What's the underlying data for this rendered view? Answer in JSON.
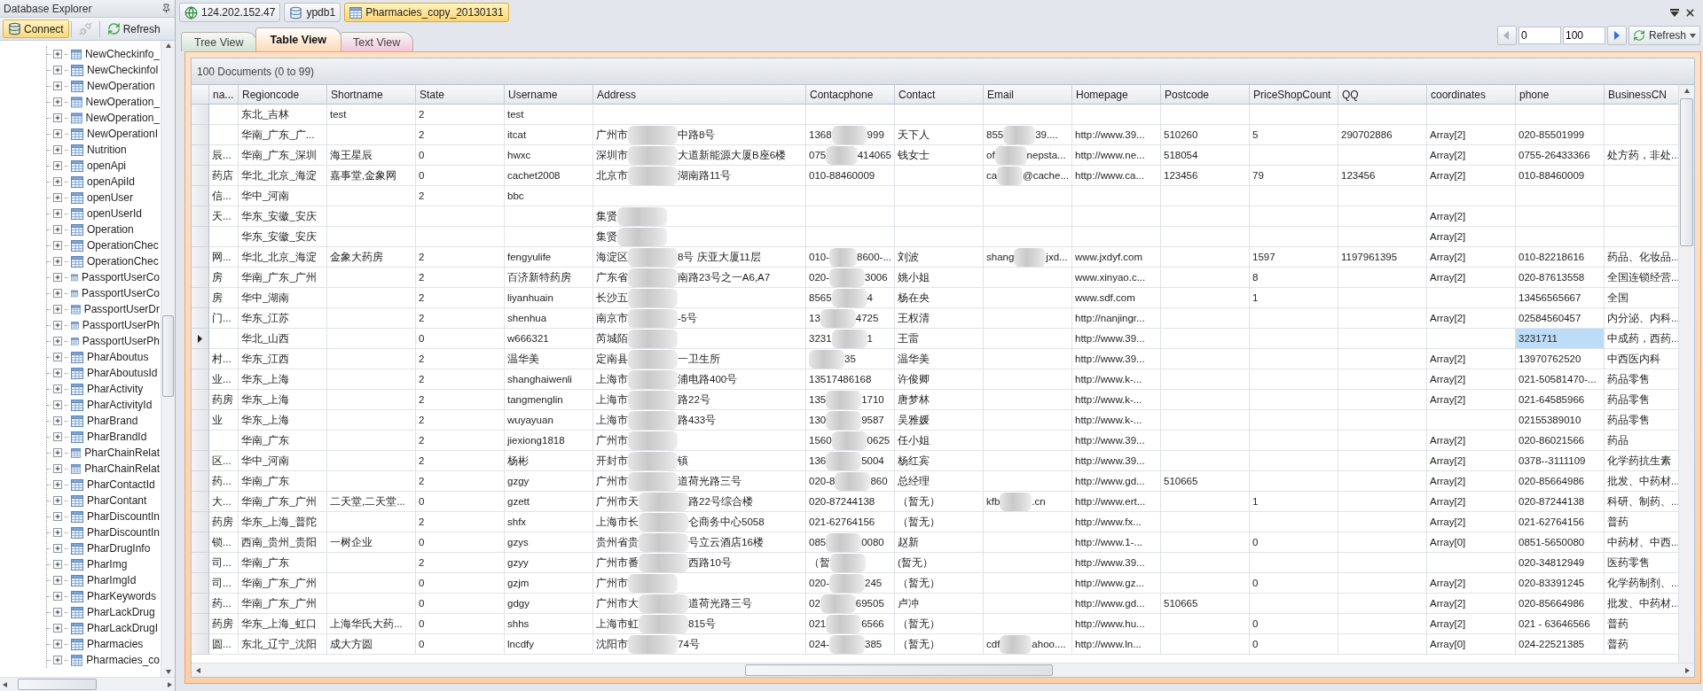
{
  "explorer": {
    "title": "Database Explorer",
    "toolbar": [
      {
        "kind": "connect",
        "label": "Connect",
        "active": true,
        "disabled": false
      },
      {
        "kind": "disconnect",
        "active": false,
        "disabled": true
      },
      {
        "kind": "refresh",
        "label": "Refresh",
        "active": false,
        "disabled": false
      }
    ],
    "items": [
      {
        "label": "NewCheckinfo_",
        "expanded": false
      },
      {
        "label": "NewCheckinfoI",
        "expanded": false
      },
      {
        "label": "NewOperation",
        "expanded": false
      },
      {
        "label": "NewOperation_",
        "expanded": false
      },
      {
        "label": "NewOperation_",
        "expanded": false
      },
      {
        "label": "NewOperationI",
        "expanded": false
      },
      {
        "label": "Nutrition",
        "expanded": false
      },
      {
        "label": "openApi",
        "expanded": false
      },
      {
        "label": "openApiId",
        "expanded": false
      },
      {
        "label": "openUser",
        "expanded": false
      },
      {
        "label": "openUserId",
        "expanded": false
      },
      {
        "label": "Operation",
        "expanded": false
      },
      {
        "label": "OperationChec",
        "expanded": false
      },
      {
        "label": "OperationChec",
        "expanded": false
      },
      {
        "label": "PassportUserCo",
        "expanded": false
      },
      {
        "label": "PassportUserCo",
        "expanded": false
      },
      {
        "label": "PassportUserDr",
        "expanded": false
      },
      {
        "label": "PassportUserPh",
        "expanded": false
      },
      {
        "label": "PassportUserPh",
        "expanded": false
      },
      {
        "label": "PharAboutus",
        "expanded": false
      },
      {
        "label": "PharAboutusId",
        "expanded": false
      },
      {
        "label": "PharActivity",
        "expanded": false
      },
      {
        "label": "PharActivityId",
        "expanded": false
      },
      {
        "label": "PharBrand",
        "expanded": false
      },
      {
        "label": "PharBrandId",
        "expanded": false
      },
      {
        "label": "PharChainRelat",
        "expanded": false
      },
      {
        "label": "PharChainRelat",
        "expanded": false
      },
      {
        "label": "PharContactId",
        "expanded": false
      },
      {
        "label": "PharContant",
        "expanded": false
      },
      {
        "label": "PharDiscountIn",
        "expanded": false
      },
      {
        "label": "PharDiscountIn",
        "expanded": false
      },
      {
        "label": "PharDrugInfo",
        "expanded": false
      },
      {
        "label": "PharImg",
        "expanded": false
      },
      {
        "label": "PharImgId",
        "expanded": false
      },
      {
        "label": "PharKeywords",
        "expanded": false
      },
      {
        "label": "PharLackDrug",
        "expanded": false
      },
      {
        "label": "PharLackDrugI",
        "expanded": false
      },
      {
        "label": "Pharmacies",
        "expanded": false
      },
      {
        "label": "Pharmacies_co",
        "expanded": false
      }
    ]
  },
  "breadcrumbs": [
    {
      "kind": "server",
      "label": "124.202.152.47",
      "selected": false
    },
    {
      "kind": "database",
      "label": "ypdb1",
      "selected": false
    },
    {
      "kind": "collection",
      "label": "Pharmacies_copy_20130131",
      "selected": true
    }
  ],
  "tabs": [
    {
      "label": "Tree View",
      "selected": false,
      "color": "#d3e2d3"
    },
    {
      "label": "Table View",
      "selected": true,
      "color": "#fcd9b8"
    },
    {
      "label": "Text View",
      "selected": false,
      "color": "#f2c6d9"
    }
  ],
  "pager": {
    "from": "0",
    "to": "100",
    "refresh_label": "Refresh"
  },
  "grid": {
    "summary": "100 Documents (0 to 99)",
    "columns": [
      "na...",
      "Regioncode",
      "Shortname",
      "State",
      "Username",
      "Address",
      "Contacphone",
      "Contact",
      "Email",
      "Homepage",
      "Postcode",
      "PriceShopCount",
      "QQ",
      "coordinates",
      "phone",
      "BusinessCN"
    ],
    "rows": [
      {
        "selected": false,
        "cells": [
          null,
          "东北_吉林",
          "test",
          "2",
          "test",
          null,
          null,
          null,
          null,
          null,
          null,
          null,
          null,
          null,
          null,
          null
        ]
      },
      {
        "selected": false,
        "cells": [
          null,
          "华南_广东_广...",
          null,
          "2",
          "itcat",
          {
            "before": "广州市",
            "after": "中路8号"
          },
          {
            "before": "1368",
            "after": "999"
          },
          "天下人",
          {
            "before": "855",
            "after": "39...."
          },
          "http://www.39...",
          "510260",
          "5",
          "290702886",
          "Array[2]",
          "020-85501999",
          null
        ]
      },
      {
        "selected": false,
        "cells": [
          "辰...",
          "华南_广东_深圳",
          "海王星辰",
          "0",
          "hwxc",
          {
            "before": "深圳市",
            "after": "大道新能源大厦B座6楼"
          },
          {
            "before": "075",
            "after": "414065"
          },
          "钱女士",
          {
            "before": "of",
            "after": "nepsta..."
          },
          "http://www.ne...",
          "518054",
          null,
          null,
          "Array[2]",
          "0755-26433366",
          "处方药，非处..."
        ]
      },
      {
        "selected": false,
        "cells": [
          "药店",
          "华北_北京_海淀",
          "嘉事堂,金象网",
          "0",
          "cachet2008",
          {
            "before": "北京市",
            "after": "湖南路11号"
          },
          "010-88460009",
          null,
          {
            "before": "ca",
            "after": "@cache..."
          },
          "http://www.ca...",
          "123456",
          "79",
          "123456",
          "Array[2]",
          "010-88460009",
          null
        ]
      },
      {
        "selected": false,
        "cells": [
          "信...",
          "华中_河南",
          null,
          "2",
          "bbc",
          null,
          null,
          null,
          null,
          null,
          null,
          null,
          null,
          null,
          null,
          null
        ]
      },
      {
        "selected": false,
        "cells": [
          "天...",
          "华东_安徽_安庆",
          null,
          null,
          null,
          {
            "before": "集贤"
          },
          null,
          null,
          null,
          null,
          null,
          null,
          null,
          "Array[2]",
          null,
          null
        ]
      },
      {
        "selected": false,
        "cells": [
          null,
          "华东_安徽_安庆",
          null,
          null,
          null,
          {
            "before": "集贤"
          },
          null,
          null,
          null,
          null,
          null,
          null,
          null,
          "Array[2]",
          null,
          null
        ]
      },
      {
        "selected": false,
        "cells": [
          "网...",
          "华北_北京_海淀",
          "金象大药房",
          "2",
          "fengyulife",
          {
            "before": "海淀区",
            "after": "8号 庆亚大厦11层"
          },
          {
            "before": "010-",
            "after": "8600-..."
          },
          "刘波",
          {
            "before": "shang",
            "after": "jxd..."
          },
          "www.jxdyf.com",
          null,
          "1597",
          "1197961395",
          "Array[2]",
          "010-82218616",
          "药品、化妆品..."
        ]
      },
      {
        "selected": false,
        "cells": [
          "房",
          "华南_广东_广州",
          null,
          "2",
          "百济新特药房",
          {
            "before": "广东省",
            "after": "南路23号之一A6,A7"
          },
          {
            "before": "020-",
            "after": "3006"
          },
          "姚小姐",
          null,
          "www.xinyao.c...",
          null,
          "8",
          null,
          "Array[2]",
          "020-87613558",
          "全国连锁经营..."
        ]
      },
      {
        "selected": false,
        "cells": [
          "房",
          "华中_湖南",
          null,
          "2",
          "liyanhuain",
          {
            "before": "长沙五"
          },
          {
            "before": "8565",
            "after": "4"
          },
          "杨在央",
          null,
          "www.sdf.com",
          null,
          "1",
          null,
          null,
          "13456565667",
          "全国"
        ]
      },
      {
        "selected": false,
        "cells": [
          "门...",
          "华东_江苏",
          null,
          "2",
          "shenhua",
          {
            "before": "南京市",
            "after": "-5号"
          },
          {
            "before": "13",
            "after": "4725"
          },
          "王权清",
          null,
          "http://nanjingr...",
          null,
          null,
          null,
          "Array[2]",
          "02584560457",
          "内分泌、内科..."
        ]
      },
      {
        "selected": true,
        "cells": [
          null,
          "华北_山西",
          null,
          "0",
          "w666321",
          {
            "before": "芮城陌"
          },
          {
            "before": "3231",
            "after": "1"
          },
          "王雷",
          null,
          "http://www.39...",
          null,
          null,
          null,
          null,
          {
            "text": "3231711",
            "focused": true
          },
          "中成药，西药..."
        ]
      },
      {
        "selected": false,
        "cells": [
          "村...",
          "华东_江西",
          null,
          "2",
          "温华美",
          {
            "before": "定南县",
            "after": "一卫生所"
          },
          {
            "after": "35"
          },
          "温华美",
          null,
          "http://www.39...",
          null,
          null,
          null,
          "Array[2]",
          "13970762520",
          "中西医内科"
        ]
      },
      {
        "selected": false,
        "cells": [
          "业...",
          "华东_上海",
          null,
          "2",
          "shanghaiwenli",
          {
            "before": "上海市",
            "after": "浦电路400号"
          },
          "13517486168",
          "许俊卿",
          null,
          "http://www.k-...",
          null,
          null,
          null,
          "Array[2]",
          "021-50581470-...",
          "药品零售"
        ]
      },
      {
        "selected": false,
        "cells": [
          "药房",
          "华东_上海",
          null,
          "2",
          "tangmenglin",
          {
            "before": "上海市",
            "after": "路22号"
          },
          {
            "before": "135",
            "after": "1710"
          },
          "唐梦林",
          null,
          "http://www.k-...",
          null,
          null,
          null,
          "Array[2]",
          "021-64585966",
          "药品零售"
        ]
      },
      {
        "selected": false,
        "cells": [
          "业",
          "华东_上海",
          null,
          "2",
          "wuyayuan",
          {
            "before": "上海市",
            "after": "路433号"
          },
          {
            "before": "130",
            "after": "9587"
          },
          "吴雅媛",
          null,
          "http://www.k-...",
          null,
          null,
          null,
          null,
          "02155389010",
          "药品零售"
        ]
      },
      {
        "selected": false,
        "cells": [
          null,
          "华南_广东",
          null,
          "2",
          "jiexiong1818",
          {
            "before": "广州市"
          },
          {
            "before": "1560",
            "after": "0625"
          },
          "任小姐",
          null,
          "http://www.39...",
          null,
          null,
          null,
          "Array[2]",
          "020-86021566",
          "药品"
        ]
      },
      {
        "selected": false,
        "cells": [
          "区...",
          "华中_河南",
          null,
          "2",
          "杨彬",
          {
            "before": "开封市",
            "after": "镇"
          },
          {
            "before": "136",
            "after": "5004"
          },
          "杨红宾",
          null,
          "http://www.39...",
          null,
          null,
          null,
          "Array[2]",
          "0378--3111109",
          "化学药抗生素"
        ]
      },
      {
        "selected": false,
        "cells": [
          "药...",
          "华南_广东",
          null,
          "2",
          "gzgy",
          {
            "before": "广州市",
            "after": "道荷光路三号"
          },
          {
            "before": "020-8",
            "after": "860"
          },
          "总经理",
          null,
          "http://www.gd...",
          "510665",
          null,
          null,
          "Array[2]",
          "020-85664986",
          "批发、中药材..."
        ]
      },
      {
        "selected": false,
        "cells": [
          "大...",
          "华南_广东_广州",
          "二天堂,二天堂...",
          "0",
          "gzett",
          {
            "before": "广州市天",
            "after": "路22号综合楼"
          },
          "020-87244138",
          "（暂无）",
          {
            "before": "kfb",
            "after": ".cn"
          },
          "http://www.ert...",
          null,
          "1",
          null,
          "Array[2]",
          "020-87244138",
          "科研、制药、..."
        ]
      },
      {
        "selected": false,
        "cells": [
          "药房",
          "华东_上海_普陀",
          null,
          "2",
          "shfx",
          {
            "before": "上海市长",
            "after": "仑商务中心5058"
          },
          "021-62764156",
          "（暂无）",
          null,
          "http://www.fx...",
          null,
          null,
          null,
          "Array[2]",
          "021-62764156",
          "普药"
        ]
      },
      {
        "selected": false,
        "cells": [
          "锁...",
          "西南_贵州_贵阳",
          "一树企业",
          "0",
          "gzys",
          {
            "before": "贵州省贵",
            "after": "号立云酒店16楼"
          },
          {
            "before": "085",
            "after": "0080"
          },
          "赵新",
          null,
          "http://www.1-...",
          null,
          "0",
          null,
          "Array[0]",
          "0851-5650080",
          "中药材、中西..."
        ]
      },
      {
        "selected": false,
        "cells": [
          "司...",
          "华南_广东",
          null,
          "2",
          "gzyy",
          {
            "before": "广州市番",
            "after": "西路10号"
          },
          {
            "before": "（暂"
          },
          "(暂无）",
          null,
          "http://www.39...",
          null,
          null,
          null,
          null,
          "020-34812949",
          "医药零售"
        ]
      },
      {
        "selected": false,
        "cells": [
          "司...",
          "华南_广东_广州",
          null,
          "0",
          "gzjm",
          {
            "before": "广州市"
          },
          {
            "before": "020-",
            "after": "245"
          },
          "（暂无）",
          null,
          "http://www.gz...",
          null,
          "0",
          null,
          "Array[2]",
          "020-83391245",
          "化学药制剂、..."
        ]
      },
      {
        "selected": false,
        "cells": [
          "药...",
          "华南_广东_广州",
          null,
          "0",
          "gdgy",
          {
            "before": "广州市大",
            "after": "道荷光路三号"
          },
          {
            "before": "02",
            "after": "69505"
          },
          "卢冲",
          null,
          "http://www.gd...",
          "510665",
          null,
          null,
          "Array[2]",
          "020-85664986",
          "批发、中药材..."
        ]
      },
      {
        "selected": false,
        "cells": [
          "药房",
          "华东_上海_虹口",
          "上海华氏大药...",
          "0",
          "shhs",
          {
            "before": "上海市虹",
            "after": "815号"
          },
          {
            "before": "021",
            "after": "6566"
          },
          "（暂无）",
          null,
          "http://www.hu...",
          null,
          "0",
          null,
          "Array[2]",
          "021 - 63646566",
          "普药"
        ]
      },
      {
        "selected": false,
        "cells": [
          "圆...",
          "东北_辽宁_沈阳",
          "成大方圆",
          "0",
          "lncdfy",
          {
            "before": "沈阳市",
            "after": "74号"
          },
          {
            "before": "024-",
            "after": "385"
          },
          "（暂无）",
          {
            "before": "cdf",
            "after": "ahoo...."
          },
          "http://www.ln...",
          null,
          "0",
          null,
          "Array[0]",
          "024-22521385",
          "普药"
        ]
      }
    ]
  }
}
